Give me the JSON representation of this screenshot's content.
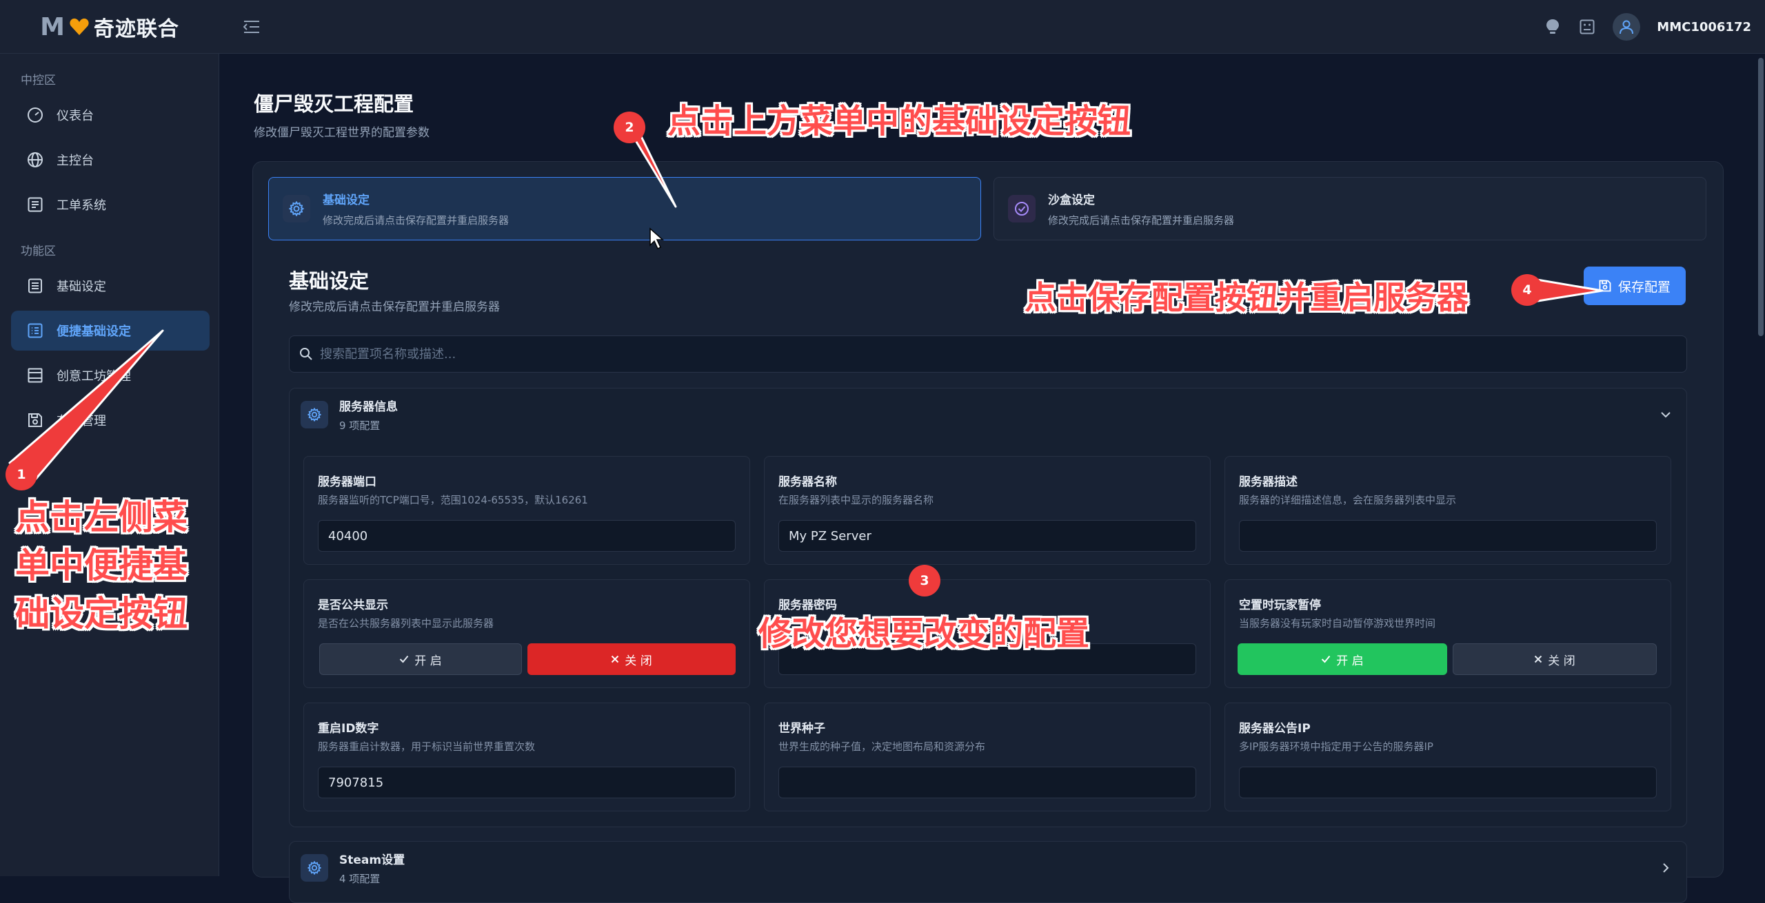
{
  "brand": {
    "logo_letter": "M",
    "name": "奇迹联合"
  },
  "header": {
    "username": "MMC1006172"
  },
  "sidebar": {
    "groups": [
      {
        "label": "中控区",
        "items": [
          {
            "label": "仪表台"
          },
          {
            "label": "主控台"
          },
          {
            "label": "工单系统"
          }
        ]
      },
      {
        "label": "功能区",
        "items": [
          {
            "label": "基础设定"
          },
          {
            "label": "便捷基础设定"
          },
          {
            "label": "创意工坊管理"
          },
          {
            "label": "存档管理"
          }
        ]
      }
    ]
  },
  "page": {
    "title": "僵尸毁灭工程配置",
    "subtitle": "修改僵尸毁灭工程世界的配置参数"
  },
  "tabs": [
    {
      "title": "基础设定",
      "desc": "修改完成后请点击保存配置并重启服务器"
    },
    {
      "title": "沙盒设定",
      "desc": "修改完成后请点击保存配置并重启服务器"
    }
  ],
  "section": {
    "title": "基础设定",
    "desc": "修改完成后请点击保存配置并重启服务器",
    "save_label": "保存配置"
  },
  "search": {
    "placeholder": "搜索配置项名称或描述..."
  },
  "groups": [
    {
      "title": "服务器信息",
      "count": "9 项配置",
      "fields": [
        {
          "name": "服务器端口",
          "desc": "服务器监听的TCP端口号，范围1024-65535，默认16261",
          "value": "40400"
        },
        {
          "name": "服务器名称",
          "desc": "在服务器列表中显示的服务器名称",
          "value": "My PZ Server"
        },
        {
          "name": "服务器描述",
          "desc": "服务器的详细描述信息，会在服务器列表中显示",
          "value": ""
        },
        {
          "name": "是否公共显示",
          "desc": "是否在公共服务器列表中显示此服务器",
          "on_label": "开 启",
          "off_label": "关 闭",
          "state": "off"
        },
        {
          "name": "服务器密码",
          "desc": "",
          "value": ""
        },
        {
          "name": "空置时玩家暂停",
          "desc": "当服务器没有玩家时自动暂停游戏世界时间",
          "on_label": "开 启",
          "off_label": "关 闭",
          "state": "on"
        },
        {
          "name": "重启ID数字",
          "desc": "服务器重启计数器，用于标识当前世界重置次数",
          "value": "7907815"
        },
        {
          "name": "世界种子",
          "desc": "世界生成的种子值，决定地图布局和资源分布",
          "value": ""
        },
        {
          "name": "服务器公告IP",
          "desc": "多IP服务器环境中指定用于公告的服务器IP",
          "value": ""
        }
      ]
    },
    {
      "title": "Steam设置",
      "count": "4 项配置"
    }
  ],
  "annotations": {
    "badge1": "1",
    "badge2": "2",
    "badge3": "3",
    "badge4": "4",
    "note1_line1": "点击左侧菜",
    "note1_line2": "单中便捷基",
    "note1_line3": "础设定按钮",
    "note2": "点击上方菜单中的基础设定按钮",
    "note3": "修改您想要改变的配置",
    "note4": "点击保存配置按钮并重启服务器"
  },
  "colors": {
    "accent": "#3b82f6",
    "danger": "#dc2626",
    "success": "#22c55e",
    "annotation": "#ef3b3b"
  }
}
